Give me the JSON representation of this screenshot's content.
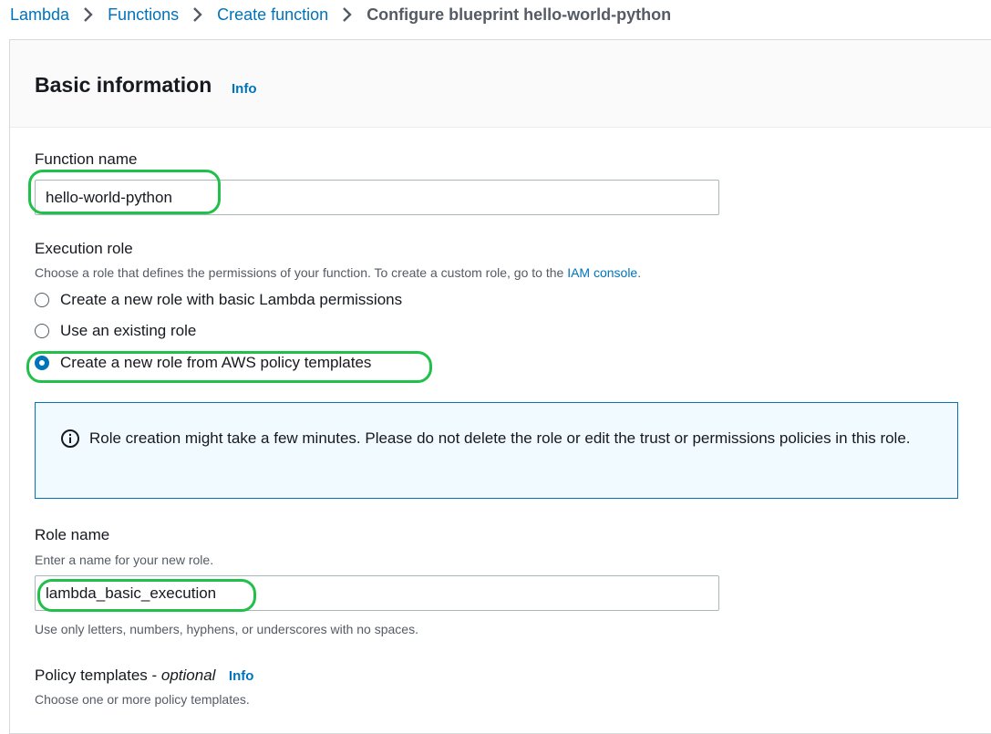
{
  "breadcrumb": {
    "items": [
      "Lambda",
      "Functions",
      "Create function"
    ],
    "current": "Configure blueprint hello-world-python"
  },
  "panel": {
    "title": "Basic information",
    "info_label": "Info"
  },
  "function_name": {
    "label": "Function name",
    "value": "hello-world-python"
  },
  "execution_role": {
    "label": "Execution role",
    "description": "Choose a role that defines the permissions of your function. To create a custom role, go to the ",
    "link_text": "IAM console",
    "description_end": ".",
    "options": [
      {
        "label": "Create a new role with basic Lambda permissions",
        "selected": false
      },
      {
        "label": "Use an existing role",
        "selected": false
      },
      {
        "label": "Create a new role from AWS policy templates",
        "selected": true
      }
    ]
  },
  "alert": {
    "text": "Role creation might take a few minutes. Please do not delete the role or edit the trust or permissions policies in this role."
  },
  "role_name": {
    "label": "Role name",
    "description": "Enter a name for your new role.",
    "value": "lambda_basic_execution",
    "constraint": "Use only letters, numbers, hyphens, or underscores with no spaces."
  },
  "policy_templates": {
    "label": "Policy templates - ",
    "optional": "optional",
    "info_label": "Info",
    "description": "Choose one or more policy templates."
  },
  "colors": {
    "link": "#0073bb",
    "highlight": "#20c04a",
    "alert_bg": "#f1faff"
  }
}
